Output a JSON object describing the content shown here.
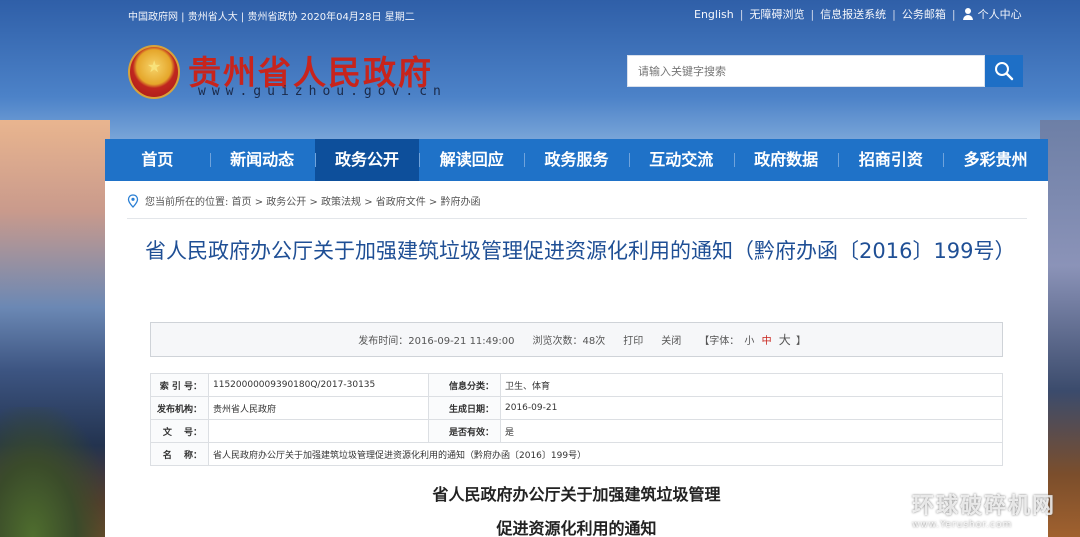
{
  "topbar": {
    "left": "中国政府网 | 贵州省人大 | 贵州省政协    2020年04月28日  星期二",
    "links": [
      "English",
      "无障碍浏览",
      "信息报送系统",
      "公务邮箱"
    ],
    "user_center": "个人中心"
  },
  "header": {
    "title": "贵州省人民政府",
    "url": "www.guizhou.gov.cn"
  },
  "search": {
    "placeholder": "请输入关键字搜索"
  },
  "nav": [
    "首页",
    "新闻动态",
    "政务公开",
    "解读回应",
    "政务服务",
    "互动交流",
    "政府数据",
    "招商引资",
    "多彩贵州"
  ],
  "breadcrumb": "您当前所在的位置: 首页 > 政务公开 > 政策法规 > 省政府文件 > 黔府办函",
  "document": {
    "title": "省人民政府办公厅关于加强建筑垃圾管理促进资源化利用的通知（黔府办函〔2016〕199号）",
    "publish_time": "发布时间：2016-09-21 11:49:00",
    "views": "浏览次数：48次",
    "print": "打印",
    "close": "关闭",
    "font_label": "【字体：",
    "font_small": "小",
    "font_medium": "中",
    "font_large": "大",
    "font_end": "】"
  },
  "info_table": {
    "index_label": "索 引 号：",
    "index_value": "11520000009390180Q/2017-30135",
    "category_label": "信息分类：",
    "category_value": "卫生、体育",
    "publisher_label": "发布机构：",
    "publisher_value": "贵州省人民政府",
    "date_label": "生成日期：",
    "date_value": "2016-09-21",
    "docno_label": "文　 号：",
    "docno_value": "",
    "valid_label": "是否有效：",
    "valid_value": "是",
    "name_label": "名　 称：",
    "name_value": "省人民政府办公厅关于加强建筑垃圾管理促进资源化利用的通知（黔府办函〔2016〕199号）"
  },
  "body": {
    "heading_line1": "省人民政府办公厅关于加强建筑垃圾管理",
    "heading_line2": "促进资源化利用的通知"
  },
  "watermark": {
    "name": "环球破碎机网",
    "url": "www.Yerushor.com"
  }
}
